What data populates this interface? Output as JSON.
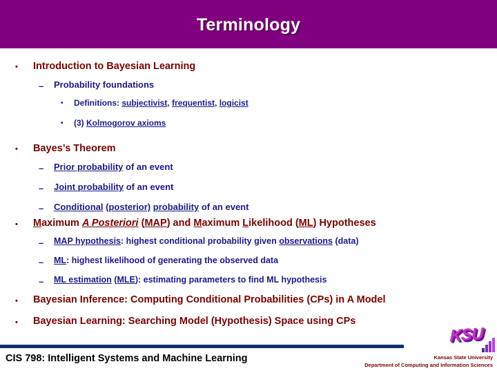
{
  "slide": {
    "title": "Terminology",
    "title_band_color": "#800080",
    "level1_color": "#7B0000",
    "level2_color": "#1A1A8C",
    "bullet_marker_l1": "•",
    "bullet_marker_l2": "–",
    "bullet_marker_l3": "•"
  },
  "content": {
    "b1": {
      "text": "Introduction to Bayesian Learning"
    },
    "b1s1": {
      "text": "Probability foundations"
    },
    "b1s1a": {
      "prefix": "Definitions: ",
      "term1": "subjectivist",
      "sep1": ", ",
      "term2": "frequentist",
      "sep2": ", ",
      "term3": "logicist"
    },
    "b1s1b": {
      "prefix": "(3) ",
      "term1": "Kolmogorov axioms"
    },
    "b2": {
      "text": "Bayes’s Theorem"
    },
    "b2s1": {
      "term1": "Prior probability",
      "suffix": " of an event"
    },
    "b2s2": {
      "term1": "Joint probability",
      "suffix": " of an event"
    },
    "b2s3": {
      "term1": "Conditional",
      "sep1": " ",
      "term2": "(posterior)",
      "sep2": " ",
      "term3": "probability",
      "suffix": " of an event"
    },
    "b3": {
      "u1": "M",
      "t1": "aximum ",
      "ui1": "A Posteriori",
      "t2": " (",
      "u2": "MAP",
      "t3": ") and ",
      "u3": "M",
      "t4": "aximum ",
      "u4": "L",
      "t5": "ikelihood (",
      "u5": "ML",
      "t6": ") Hypotheses"
    },
    "b3s1": {
      "term1": "MAP hypothesis",
      "mid": ": highest conditional probability given ",
      "term2": "observations",
      "suffix": " (data)"
    },
    "b3s2": {
      "term1": "ML",
      "suffix": ": highest likelihood of generating the observed data"
    },
    "b3s3": {
      "term1": "ML estimation",
      "mid": " (",
      "term2": "MLE",
      "suffix": "): estimating parameters to find ML hypothesis"
    },
    "b4": {
      "text": "Bayesian Inference: Computing Conditional Probabilities (CPs) in A Model"
    },
    "b5": {
      "text": "Bayesian Learning: Searching Model (Hypothesis) Space using CPs"
    }
  },
  "footer": {
    "course": "CIS 798: Intelligent Systems and Machine Learning",
    "university": "Kansas State University",
    "department": "Department of Computing and Information Sciences",
    "logo_text": "KSU"
  }
}
